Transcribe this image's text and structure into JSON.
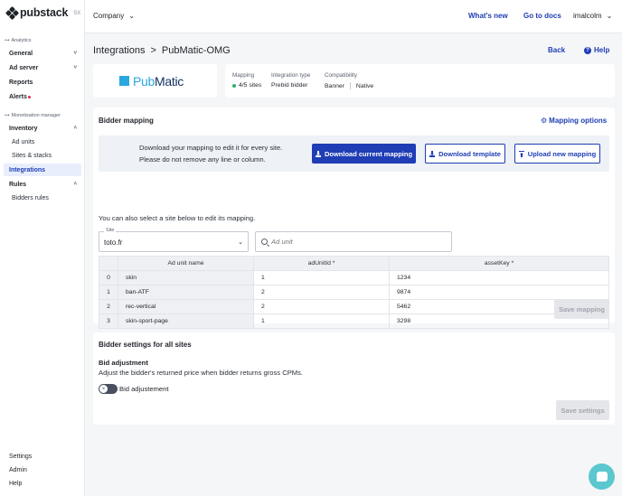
{
  "brand": {
    "name": "pubstack",
    "tag": "SX"
  },
  "sidebar": {
    "analytics_label": "Analytics",
    "analytics_items": [
      {
        "label": "General",
        "chevron": "˅"
      },
      {
        "label": "Ad server",
        "chevron": "˅"
      },
      {
        "label": "Reports"
      },
      {
        "label": "Alerts"
      }
    ],
    "monetisation_label": "Monetisation manager",
    "inventory": {
      "label": "Inventory",
      "chevron": "˄"
    },
    "inventory_items": [
      "Ad units",
      "Sites & stacks",
      "Integrations"
    ],
    "rules": {
      "label": "Rules",
      "chevron": "˄"
    },
    "rules_items": [
      "Bidders rules"
    ],
    "bottom_items": [
      "Settings",
      "Admin",
      "Help"
    ],
    "active": "Integrations"
  },
  "topbar": {
    "company": "Company",
    "whats_new": "What's new",
    "go_to_docs": "Go to docs",
    "user": "imalcolm"
  },
  "page": {
    "breadcrumb_root": "Integrations",
    "breadcrumb_sep": ">",
    "breadcrumb_current": "PubMatic-OMG",
    "back": "Back",
    "help": "Help"
  },
  "logo": {
    "part1": "Pub",
    "part2": "Matic"
  },
  "info": {
    "mapping_label": "Mapping",
    "mapping_value": "4/5 sites",
    "integration_type_label": "Integration type",
    "integration_type_value": "Prebid bidder",
    "compatibility_label": "Compatibility",
    "compat_1": "Banner",
    "compat_2": "Native"
  },
  "bidder_mapping": {
    "title": "Bidder mapping",
    "options": "Mapping options",
    "download_text_1": "Download your mapping to edit it for every site.",
    "download_text_2": "Please do not remove any line or column.",
    "download_current": "Download current mapping",
    "download_template": "Download template",
    "upload_new": "Upload new mapping",
    "select_note": "You can also select a site below to edit its mapping.",
    "site_label": "Site",
    "site_value": "toto.fr",
    "adunit_placeholder": "Ad unit",
    "columns": [
      "",
      "Ad unit name",
      "adUnitId *",
      "assetKey *"
    ],
    "rows": [
      {
        "idx": "0",
        "name": "skin",
        "adunit": "1",
        "asset": "1234"
      },
      {
        "idx": "1",
        "name": "ban-ATF",
        "adunit": "2",
        "asset": "9874"
      },
      {
        "idx": "2",
        "name": "rec-vertical",
        "adunit": "2",
        "asset": "5462"
      },
      {
        "idx": "3",
        "name": "skin-sport-page",
        "adunit": "1",
        "asset": "3298"
      }
    ],
    "save": "Save mapping"
  },
  "bidder_settings": {
    "title": "Bidder settings for all sites",
    "bid_adj_title": "Bid adjustment",
    "bid_adj_desc": "Adjust the bidder's returned price when bidder returns gross CPMs.",
    "toggle_label": "Bid adjustement",
    "toggle_on": false,
    "save": "Save settings"
  },
  "colors": {
    "accent": "#1f3db5",
    "pubmatic": "#2aa6e0",
    "chat": "#5bc7cf"
  }
}
